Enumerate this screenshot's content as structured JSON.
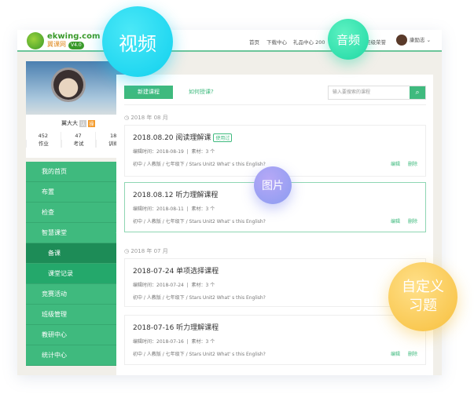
{
  "header": {
    "logo_name": "ekwing.com",
    "logo_sub": "翼课网",
    "version": "V4.0",
    "nav": [
      "首页",
      "下载中心",
      "礼品中心 200",
      "班级荣誉"
    ],
    "user": "康励志"
  },
  "profile": {
    "name": "翼大大",
    "tags": [
      "认",
      "操"
    ],
    "stats": [
      {
        "value": "452",
        "label": "作业"
      },
      {
        "value": "47",
        "label": "考试"
      },
      {
        "value": "18",
        "label": "训练"
      }
    ]
  },
  "menu": [
    {
      "label": "我的首页"
    },
    {
      "label": "布置",
      "toggle": "+"
    },
    {
      "label": "检查",
      "toggle": "+"
    },
    {
      "label": "智慧课堂",
      "toggle": "−"
    },
    {
      "label": "备课"
    },
    {
      "label": "课堂记录"
    },
    {
      "label": "竞赛活动"
    },
    {
      "label": "班级管理"
    },
    {
      "label": "教研中心"
    },
    {
      "label": "统计中心"
    }
  ],
  "toolbar": {
    "new_course": "新建课程",
    "how": "如何授课?",
    "search_placeholder": "输入要搜索的课程"
  },
  "groups": [
    {
      "date": "2018 年 08 月",
      "cards": [
        {
          "title": "2018.08.20 阅读理解课",
          "badge": "使用过",
          "edit_time": "编辑时间：2018-08-19",
          "material": "素材：3 个",
          "path": "初中 / 人教版 / 七年级下 / Stars Unit2 What' s this English?",
          "edit": "编辑",
          "delete": "删除"
        },
        {
          "title": "2018.08.12 听力理解课程",
          "edit_time": "编辑时间：2018-08-11",
          "material": "素材：3 个",
          "path": "初中 / 人教版 / 七年级下 / Stars Unit2 What' s this English?",
          "edit": "编辑",
          "delete": "删除"
        }
      ]
    },
    {
      "date": "2018 年 07 月",
      "cards": [
        {
          "title": "2018-07-24 单项选择课程",
          "edit_time": "编辑时间：2018-07-24",
          "material": "素材：3 个",
          "path": "初中 / 人教版 / 七年级下 / Stars Unit2 What' s this English?"
        },
        {
          "title": "2018-07-16 听力理解课程",
          "edit_time": "编辑时间：2018-07-16",
          "material": "素材：3 个",
          "path": "初中 / 人教版 / 七年级下 / Stars Unit2 What' s this English?",
          "edit": "编辑",
          "delete": "删除"
        }
      ]
    }
  ],
  "bubbles": {
    "video": "视频",
    "audio": "音频",
    "image": "图片",
    "custom": "自定义习题"
  }
}
